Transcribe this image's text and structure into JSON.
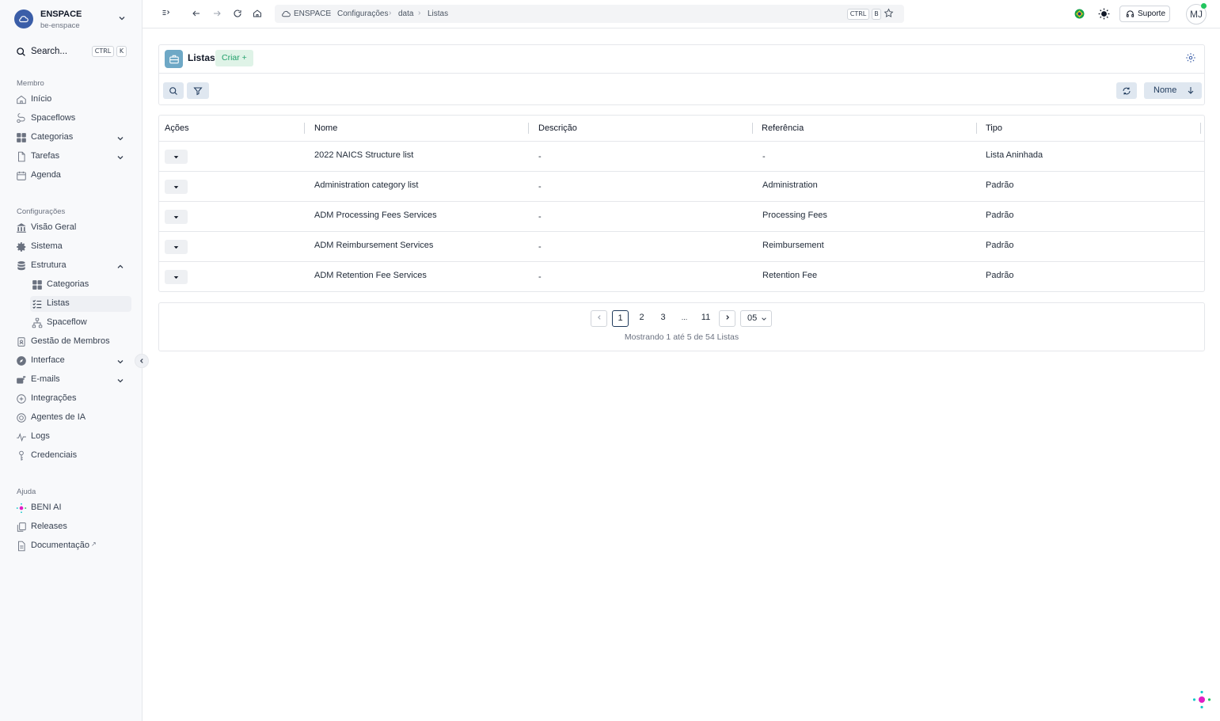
{
  "workspace": {
    "name": "ENSPACE",
    "slug": "be-enspace"
  },
  "search": {
    "label": "Search...",
    "kbd1": "CTRL",
    "kbd2": "K"
  },
  "sections": {
    "member": "Membro",
    "settings": "Configurações",
    "help": "Ajuda"
  },
  "nav_member": [
    {
      "label": "Início",
      "icon": "home-icon"
    },
    {
      "label": "Spaceflows",
      "icon": "spaceflows-icon"
    },
    {
      "label": "Categorias",
      "icon": "grid-icon"
    },
    {
      "label": "Tarefas",
      "icon": "file-icon"
    },
    {
      "label": "Agenda",
      "icon": "calendar-icon"
    }
  ],
  "nav_settings": [
    {
      "label": "Visão Geral",
      "icon": "building-icon"
    },
    {
      "label": "Sistema",
      "icon": "gear-icon"
    },
    {
      "label": "Estrutura",
      "icon": "database-icon"
    },
    {
      "label": "Categorias",
      "icon": "grid-icon"
    },
    {
      "label": "Listas",
      "icon": "list-icon"
    },
    {
      "label": "Spaceflow",
      "icon": "flow-icon"
    },
    {
      "label": "Gestão de Membros",
      "icon": "badge-icon"
    },
    {
      "label": "Interface",
      "icon": "compass-icon"
    },
    {
      "label": "E-mails",
      "icon": "mail-icon"
    },
    {
      "label": "Integrações",
      "icon": "plug-icon"
    },
    {
      "label": "Agentes de IA",
      "icon": "chip-icon"
    },
    {
      "label": "Logs",
      "icon": "activity-icon"
    },
    {
      "label": "Credenciais",
      "icon": "key-icon"
    }
  ],
  "nav_help": [
    {
      "label": "BENI AI",
      "icon": "beni-ai-icon"
    },
    {
      "label": "Releases",
      "icon": "copy-icon"
    },
    {
      "label": "Documentação",
      "icon": "doc-icon",
      "suffix": "↗"
    }
  ],
  "breadcrumb": [
    "ENSPACE",
    "Configurações",
    "data",
    "Listas"
  ],
  "topbar": {
    "kbd1": "CTRL",
    "kbd2": "B",
    "support_label": "Suporte",
    "avatar_initials": "MJ"
  },
  "panel": {
    "title": "Listas",
    "create_label": "Criar +",
    "sort_label": "Nome"
  },
  "table": {
    "headers": [
      "Ações",
      "Nome",
      "Descrição",
      "Referência",
      "Tipo"
    ],
    "rows": [
      {
        "name": "2022 NAICS Structure list",
        "description": "-",
        "reference": "-",
        "type": "Lista Aninhada"
      },
      {
        "name": "Administration category list",
        "description": "-",
        "reference": "Administration",
        "type": "Padrão"
      },
      {
        "name": "ADM Processing Fees Services",
        "description": "-",
        "reference": "Processing Fees",
        "type": "Padrão"
      },
      {
        "name": "ADM Reimbursement Services",
        "description": "-",
        "reference": "Reimbursement",
        "type": "Padrão"
      },
      {
        "name": "ADM Retention Fee Services",
        "description": "-",
        "reference": "Retention Fee",
        "type": "Padrão"
      }
    ]
  },
  "pagination": {
    "pages": [
      "1",
      "2",
      "3",
      "...",
      "11"
    ],
    "current": "1",
    "page_size": "05",
    "info": "Mostrando 1 até 5 de 54 Listas"
  },
  "colors": {
    "brand": "#3b5ea8",
    "accent_green": "#22a06b",
    "button_bg": "#dfe7f0"
  }
}
